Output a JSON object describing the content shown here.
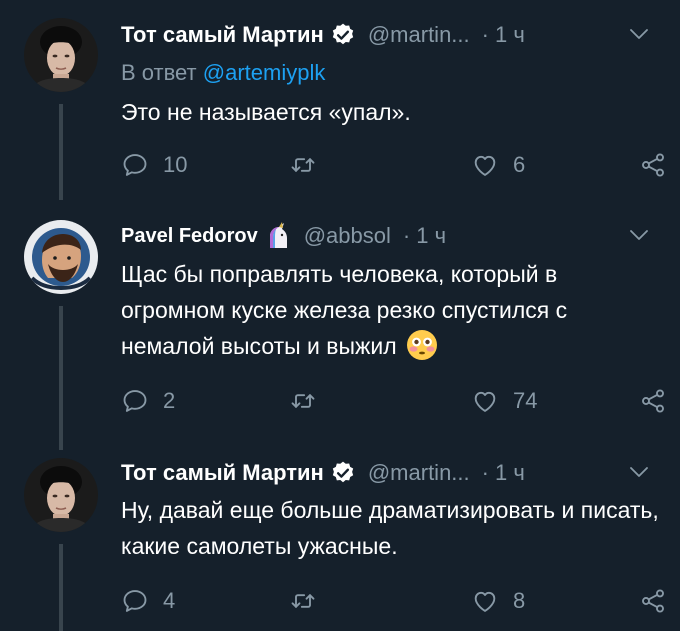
{
  "tweets": [
    {
      "name": "Тот самый Мартин",
      "handle": "@martin...",
      "separator": "·",
      "time": "1 ч",
      "reply_prefix": "В ответ",
      "reply_mention": "@artemiyplk",
      "text": "Это не называется «упал».",
      "replies": "10",
      "retweets": "",
      "likes": "6"
    },
    {
      "name": "Pavel Fedorov",
      "handle": "@abbsol",
      "separator": "·",
      "time": "1 ч",
      "text": "Щас бы поправлять человека, который в огромном куске железа резко спустился с немалой высоты и выжил",
      "replies": "2",
      "retweets": "",
      "likes": "74"
    },
    {
      "name": "Тот самый Мартин",
      "handle": "@martin...",
      "separator": "·",
      "time": "1 ч",
      "text": "Ну, давай еще больше драматизировать и писать, какие самолеты ужасные.",
      "replies": "4",
      "retweets": "",
      "likes": "8"
    }
  ],
  "colors": {
    "background": "#15202b",
    "text": "#ffffff",
    "secondary": "#8899a6",
    "accent": "#1da1f2",
    "thread_line": "#38444d"
  },
  "icons": [
    "verified-badge-icon",
    "unicorn-emoji-icon",
    "flushed-face-emoji-icon",
    "reply-icon",
    "retweet-icon",
    "like-icon",
    "share-icon",
    "chevron-down-icon"
  ]
}
